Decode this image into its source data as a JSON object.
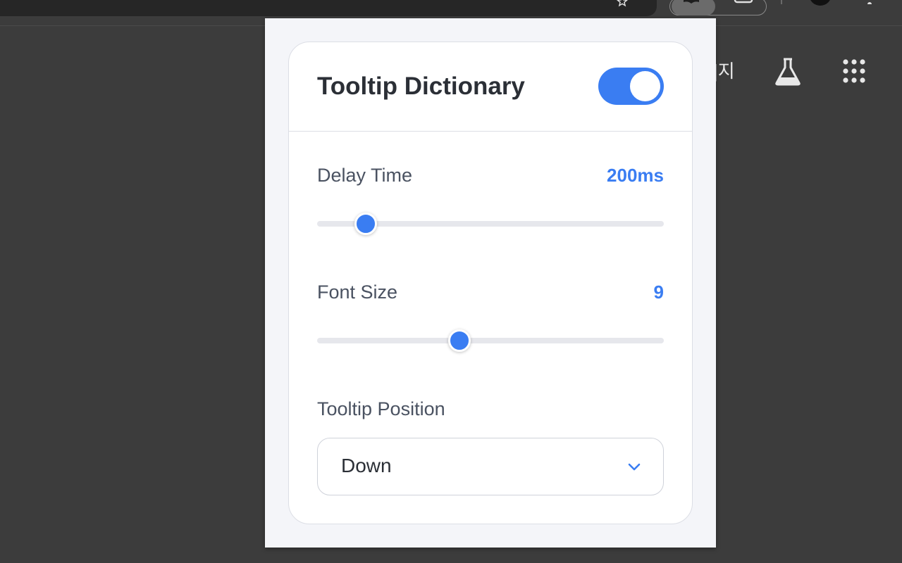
{
  "browser": {
    "page_text_fragment": "|지"
  },
  "popup": {
    "title": "Tooltip Dictionary",
    "enabled": true,
    "delay": {
      "label": "Delay Time",
      "value_text": "200ms",
      "level": 0.14
    },
    "font_size": {
      "label": "Font Size",
      "value_text": "9",
      "level": 0.41
    },
    "position": {
      "label": "Tooltip Position",
      "selected": "Down"
    }
  },
  "colors": {
    "accent": "#3a7df2",
    "browser_bg": "#3c3c3c",
    "popup_bg": "#f4f5f9",
    "label": "#4a5261"
  },
  "icons": [
    "star-icon",
    "extension-book-icon",
    "tab-icon",
    "profile-icon",
    "menu-icon",
    "flask-icon",
    "apps-grid-icon",
    "chevron-down-icon"
  ]
}
